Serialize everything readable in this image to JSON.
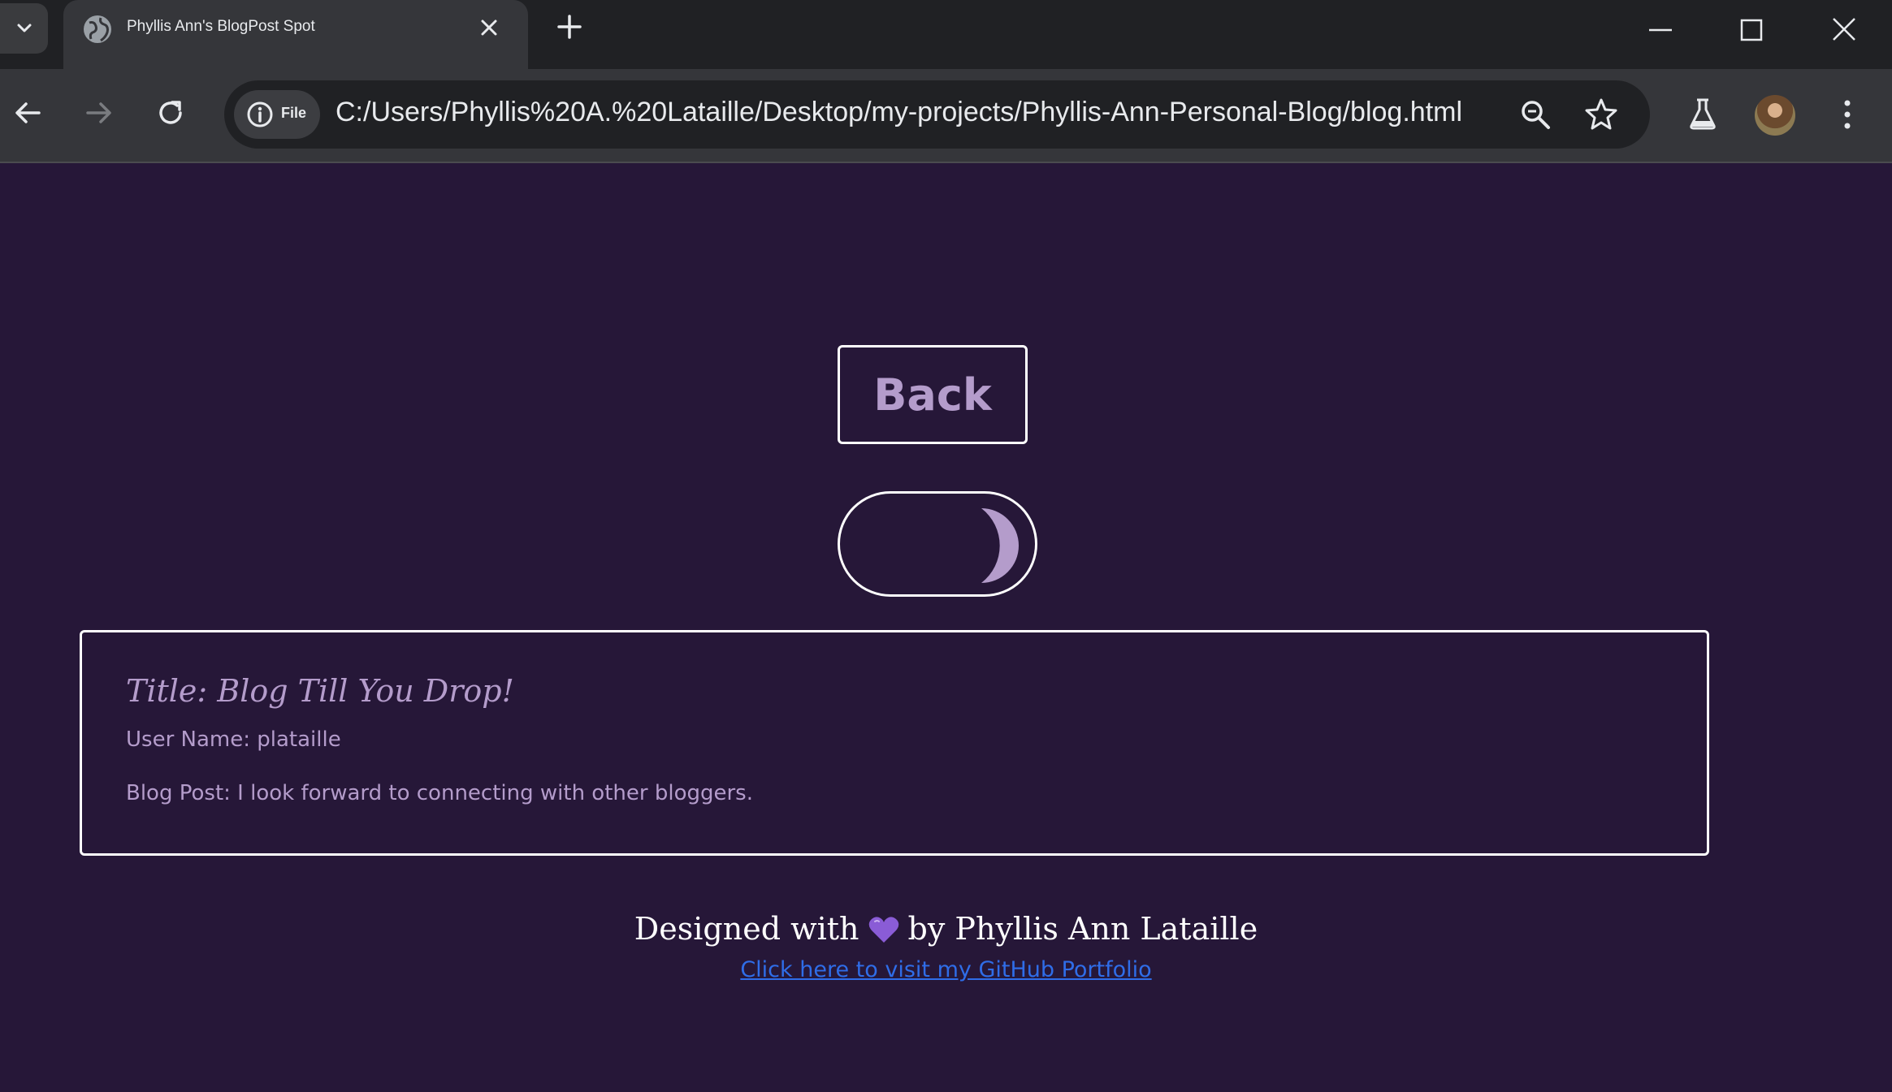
{
  "browser": {
    "tab": {
      "title": "Phyllis Ann's BlogPost Spot",
      "favicon": "globe-icon"
    },
    "site_chip_label": "File",
    "url": "C:/Users/Phyllis%20A.%20Lataille/Desktop/my-projects/Phyllis-Ann-Personal-Blog/blog.html",
    "icons": [
      "chevron-down-icon",
      "close-icon",
      "plus-icon",
      "minimize-icon",
      "maximize-icon",
      "window-close-icon",
      "back-arrow-icon",
      "forward-arrow-icon",
      "reload-icon",
      "info-icon",
      "zoom-icon",
      "star-icon",
      "labs-flask-icon",
      "profile-avatar",
      "kebab-menu-icon"
    ]
  },
  "page": {
    "back_button_label": "Back",
    "theme_toggle_icon": "moon-icon",
    "post": {
      "title": "Title: Blog Till You Drop!",
      "user": "User Name: plataille",
      "body": "Blog Post: I look forward to connecting with other bloggers."
    },
    "footer": {
      "designed_prefix": "Designed with",
      "heart_icon": "purple-heart-icon",
      "designed_suffix": "by Phyllis Ann Lataille",
      "link_text": "Click here to visit my GitHub Portfolio"
    }
  },
  "colors": {
    "page_background": "#261738",
    "accent_text": "#b49ccb",
    "link": "#2f6de8",
    "border": "#ffffff",
    "heart": "#8a5cd6"
  }
}
